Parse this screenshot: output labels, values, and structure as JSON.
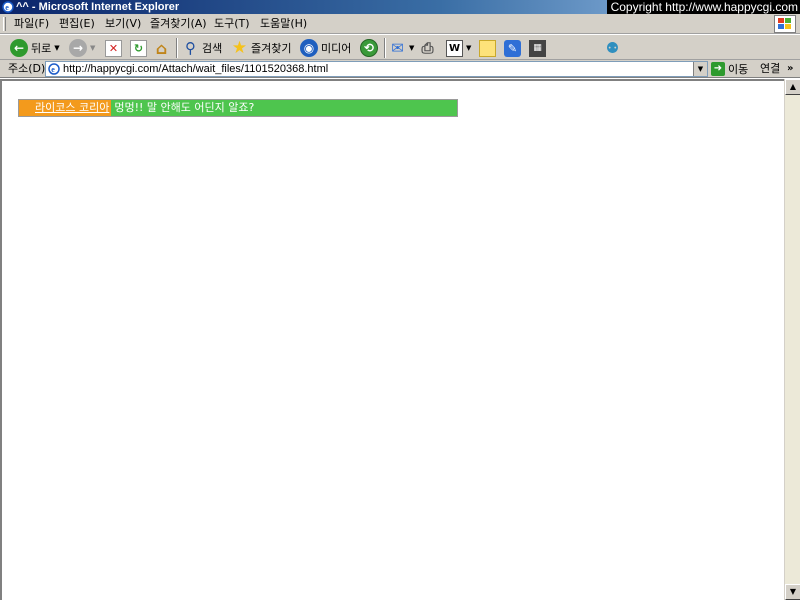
{
  "window": {
    "title": "^^ - Microsoft Internet Explorer",
    "copyright": "Copyright   http://www.happycgi.com"
  },
  "menu": [
    {
      "label": "파일(F)",
      "name": "menu-file"
    },
    {
      "label": "편집(E)",
      "name": "menu-edit"
    },
    {
      "label": "보기(V)",
      "name": "menu-view"
    },
    {
      "label": "즐겨찾기(A)",
      "name": "menu-favorites"
    },
    {
      "label": "도구(T)",
      "name": "menu-tools"
    },
    {
      "label": "도움말(H)",
      "name": "menu-help"
    }
  ],
  "toolbar": {
    "back_label": "뒤로",
    "search_label": "검색",
    "favorites_label": "즐겨찾기",
    "media_label": "미디어"
  },
  "address": {
    "label": "주소(D)",
    "url": "http://happycgi.com/Attach/wait_files/1101520368.html",
    "go_label": "이동",
    "links_label": "연결",
    "links_more": "»"
  },
  "page": {
    "brand_link": "라이코스 코리아",
    "message": "멍멍!! 말 안해도 어딘지 알죠?"
  },
  "colors": {
    "notice_green": "#4ec54e",
    "brand_orange": "#f39a1c",
    "titlebar_blue": "#0a246a"
  }
}
